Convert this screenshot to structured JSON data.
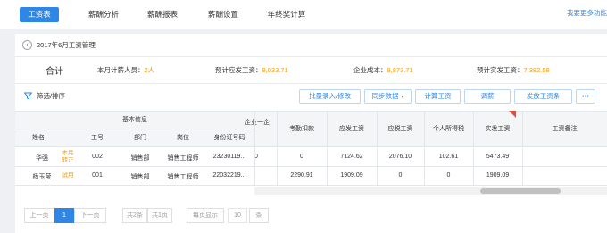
{
  "nav": {
    "tabs": [
      {
        "label": "工资表",
        "active": true
      },
      {
        "label": "薪酬分析",
        "active": false
      },
      {
        "label": "薪酬报表",
        "active": false
      },
      {
        "label": "薪酬设置",
        "active": false
      },
      {
        "label": "年终奖计算",
        "active": false
      }
    ],
    "more_link": "我要更多功能"
  },
  "breadcrumb": {
    "title": "2017年6月工资管理"
  },
  "summary": {
    "title": "合计",
    "headcount_label": "本月计薪人员：",
    "headcount_value": "2人",
    "payable_label": "预计应发工资：",
    "payable_value": "9,033.71",
    "cost_label": "企业成本：",
    "cost_value": "9,873.71",
    "actual_label": "预计实发工资：",
    "actual_value": "7,382.58"
  },
  "toolbar": {
    "filter_label": "筛选/排序",
    "batch_label": "批量录入/修改",
    "sync_label": "同步数据",
    "calc_label": "计算工资",
    "adjust_label": "调薪",
    "send_label": "发放工资条",
    "more_label": "•••"
  },
  "table": {
    "group_header": "基本信息",
    "columns": {
      "name": "姓名",
      "emp_no": "工号",
      "dept": "部门",
      "position": "岗位",
      "id_no": "身份证号码",
      "partial": "企业一企",
      "deduction": "考勤扣款",
      "payable": "应发工资",
      "taxable": "应税工资",
      "tax": "个人所得税",
      "actual": "实发工资",
      "remark": "工资备注"
    },
    "rows": [
      {
        "name": "华强",
        "badge": "本月转正",
        "emp_no": "002",
        "dept": "销售部",
        "position": "销售工程师",
        "id_no": "23230119...",
        "partial": "0",
        "deduction": "0",
        "payable": "7124.62",
        "taxable": "2076.10",
        "tax": "102.61",
        "actual": "5473.49",
        "remark": ""
      },
      {
        "name": "杨玉莹",
        "badge": "试用",
        "emp_no": "001",
        "dept": "销售部",
        "position": "销售工程师",
        "id_no": "22032219...",
        "partial": "",
        "deduction": "2290.91",
        "payable": "1909.09",
        "taxable": "0",
        "tax": "0",
        "actual": "1909.09",
        "remark": ""
      }
    ]
  },
  "pagination": {
    "prev": "上一页",
    "current": "1",
    "next": "下一页",
    "total_pages": "共2条",
    "page_count": "共1页",
    "per_page_label": "每页显示",
    "per_page_value": "10",
    "unit": "条"
  },
  "colors": {
    "accent": "#2f87e5",
    "highlight": "#f39a12",
    "flag": "#e74c3c"
  }
}
